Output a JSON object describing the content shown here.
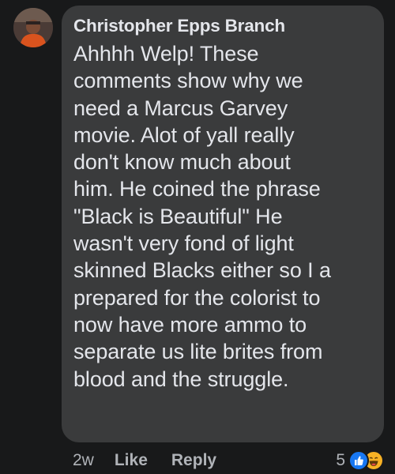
{
  "comment": {
    "author": "Christopher Epps Branch",
    "text": "Ahhhh Welp! These\ncomments show why we\nneed a Marcus Garvey\nmovie. Alot of yall really\ndon't know much about\nhim. He coined the phrase\n\"Black is Beautiful\" He\nwasn't very fond of light\nskinned Blacks either so I a\nprepared for the colorist to\nnow have more ammo to\nseparate us lite brites from\nblood and the struggle.",
    "time": "2w",
    "like_label": "Like",
    "reply_label": "Reply",
    "reaction_count": "5",
    "reaction_icons": [
      "like-reaction-icon",
      "haha-reaction-icon"
    ]
  },
  "colors": {
    "background": "#18191a",
    "bubble": "#3a3b3c",
    "text": "#e4e6eb",
    "secondary_text": "#b0b3b8",
    "like_blue": "#1877f2",
    "haha_yellow": "#f7b125"
  }
}
